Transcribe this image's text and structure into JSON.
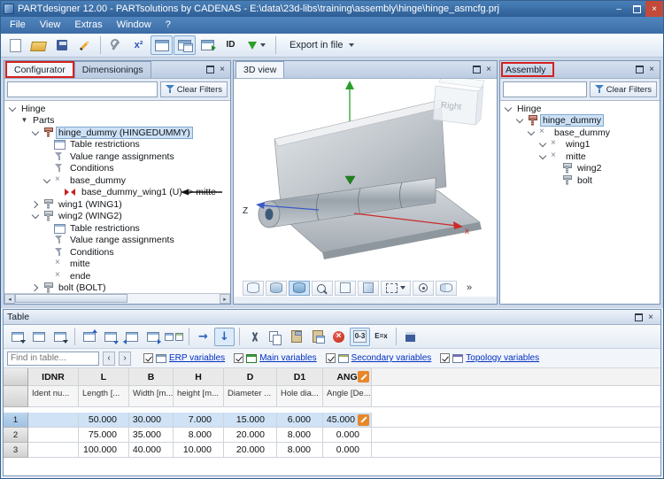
{
  "titlebar": {
    "title": "PARTdesigner 12.00 - PARTsolutions by CADENAS - E:\\data\\23d-libs\\training\\assembly\\hinge\\hinge_asmcfg.prj"
  },
  "menubar": {
    "items": [
      "File",
      "View",
      "Extras",
      "Window",
      "?"
    ]
  },
  "main_toolbar": {
    "buttons": [
      {
        "name": "new-document"
      },
      {
        "name": "open-folder"
      },
      {
        "name": "save"
      },
      {
        "name": "edit-pen"
      },
      {
        "name": "sep"
      },
      {
        "name": "tools"
      },
      {
        "name": "variable-x2"
      },
      {
        "name": "table-view",
        "active": true
      },
      {
        "name": "table-editor",
        "active": true
      },
      {
        "name": "table-link"
      },
      {
        "name": "id-badge"
      },
      {
        "name": "direction-dropdown"
      },
      {
        "name": "sep"
      }
    ],
    "export_label": "Export in file"
  },
  "configurator": {
    "tabs": [
      {
        "label": "Configurator",
        "active": true
      },
      {
        "label": "Dimensionings",
        "active": false
      }
    ],
    "clear_filters_label": "Clear Filters",
    "tree": [
      {
        "depth": 0,
        "exp": "open",
        "icon": null,
        "label": "Hinge"
      },
      {
        "depth": 1,
        "exp": "tri",
        "icon": null,
        "label": "Parts"
      },
      {
        "depth": 2,
        "exp": "open",
        "icon": "screw-red",
        "label": "hinge_dummy (HINGEDUMMY)",
        "selected": true
      },
      {
        "depth": 3,
        "exp": null,
        "icon": "table",
        "label": "Table restrictions"
      },
      {
        "depth": 3,
        "exp": null,
        "icon": "funnel",
        "label": "Value range assignments"
      },
      {
        "depth": 3,
        "exp": null,
        "icon": "funnel",
        "label": "Conditions"
      },
      {
        "depth": 3,
        "exp": "open",
        "icon": "xmark",
        "label": "base_dummy"
      },
      {
        "depth": 4,
        "exp": null,
        "icon": "bowtie-red",
        "label": "base_dummy_wing1 (U) -> mitte"
      },
      {
        "depth": 2,
        "exp": "closed",
        "icon": "screw",
        "label": "wing1 (WING1)"
      },
      {
        "depth": 2,
        "exp": "open",
        "icon": "screw",
        "label": "wing2 (WING2)"
      },
      {
        "depth": 3,
        "exp": null,
        "icon": "table",
        "label": "Table restrictions"
      },
      {
        "depth": 3,
        "exp": null,
        "icon": "funnel",
        "label": "Value range assignments"
      },
      {
        "depth": 3,
        "exp": null,
        "icon": "funnel",
        "label": "Conditions"
      },
      {
        "depth": 3,
        "exp": null,
        "icon": "xmark",
        "label": "mitte"
      },
      {
        "depth": 3,
        "exp": null,
        "icon": "xmark",
        "label": "ende"
      },
      {
        "depth": 2,
        "exp": "closed",
        "icon": "screw",
        "label": "bolt (BOLT)"
      }
    ]
  },
  "view3d": {
    "tab_label": "3D view",
    "cube_label": "Right",
    "axis_labels": {
      "x": "x",
      "z": "Z"
    },
    "toolbar": [
      {
        "name": "cylinder-wire"
      },
      {
        "name": "cylinder-half"
      },
      {
        "name": "cylinder-solid",
        "active": true
      },
      {
        "name": "zoom-fit"
      },
      {
        "name": "cube-light"
      },
      {
        "name": "cube-shaded"
      },
      {
        "name": "selection-dropdown"
      },
      {
        "name": "rotation-center"
      },
      {
        "name": "section-disc"
      },
      {
        "name": "overflow"
      }
    ]
  },
  "assembly": {
    "title": "Assembly",
    "clear_filters_label": "Clear Filters",
    "tree": [
      {
        "depth": 0,
        "exp": "open",
        "icon": null,
        "label": "Hinge"
      },
      {
        "depth": 1,
        "exp": "open",
        "icon": "screw-red",
        "label": "hinge_dummy",
        "selected": true
      },
      {
        "depth": 2,
        "exp": "open",
        "icon": "xmark",
        "label": "base_dummy"
      },
      {
        "depth": 3,
        "exp": "open",
        "icon": "xmark",
        "label": "wing1"
      },
      {
        "depth": 3,
        "exp": "open",
        "icon": "xmark",
        "label": "mitte"
      },
      {
        "depth": 4,
        "exp": null,
        "icon": "screw",
        "label": "wing2"
      },
      {
        "depth": 4,
        "exp": null,
        "icon": "screw",
        "label": "bolt"
      }
    ]
  },
  "table_panel": {
    "title": "Table",
    "toolbar": [
      {
        "name": "table-menu"
      },
      {
        "name": "table-new"
      },
      {
        "name": "table-edit"
      },
      {
        "name": "sep"
      },
      {
        "name": "row-above"
      },
      {
        "name": "row-below"
      },
      {
        "name": "col-left"
      },
      {
        "name": "col-right"
      },
      {
        "name": "merge-tables"
      },
      {
        "name": "sep"
      },
      {
        "name": "move-right"
      },
      {
        "name": "move-down",
        "active": true
      },
      {
        "name": "sep"
      },
      {
        "name": "cut"
      },
      {
        "name": "copy"
      },
      {
        "name": "paste"
      },
      {
        "name": "paste-special"
      },
      {
        "name": "delete"
      },
      {
        "name": "badge-03",
        "active": true
      },
      {
        "name": "formula-ex"
      },
      {
        "name": "sep"
      },
      {
        "name": "save"
      }
    ],
    "find_placeholder": "Find in table...",
    "filters": [
      {
        "label": "ERP variables",
        "checked": true,
        "icon": "erp"
      },
      {
        "label": "Main variables",
        "checked": true,
        "icon": "main"
      },
      {
        "label": "Secondary variables",
        "checked": true,
        "icon": "secondary"
      },
      {
        "label": "Topology variables",
        "checked": true,
        "icon": "topology"
      }
    ],
    "columns": [
      {
        "key": "IDNR",
        "desc": "Ident nu..."
      },
      {
        "key": "L",
        "desc": "Length [..."
      },
      {
        "key": "B",
        "desc": "Width [m..."
      },
      {
        "key": "H",
        "desc": "height [m..."
      },
      {
        "key": "D",
        "desc": "Diameter ..."
      },
      {
        "key": "D1",
        "desc": "Hole dia..."
      },
      {
        "key": "ANG",
        "desc": "Angle [De...",
        "editable": true
      }
    ],
    "rows": [
      {
        "num": "1",
        "selected": true,
        "ang_editable": true,
        "values": [
          "",
          "50.000",
          "30.000",
          "7.000",
          "15.000",
          "6.000",
          "45.000"
        ]
      },
      {
        "num": "2",
        "values": [
          "",
          "75.000",
          "35.000",
          "8.000",
          "20.000",
          "8.000",
          "0.000"
        ]
      },
      {
        "num": "3",
        "values": [
          "",
          "100.000",
          "40.000",
          "10.000",
          "20.000",
          "8.000",
          "0.000"
        ]
      }
    ]
  }
}
